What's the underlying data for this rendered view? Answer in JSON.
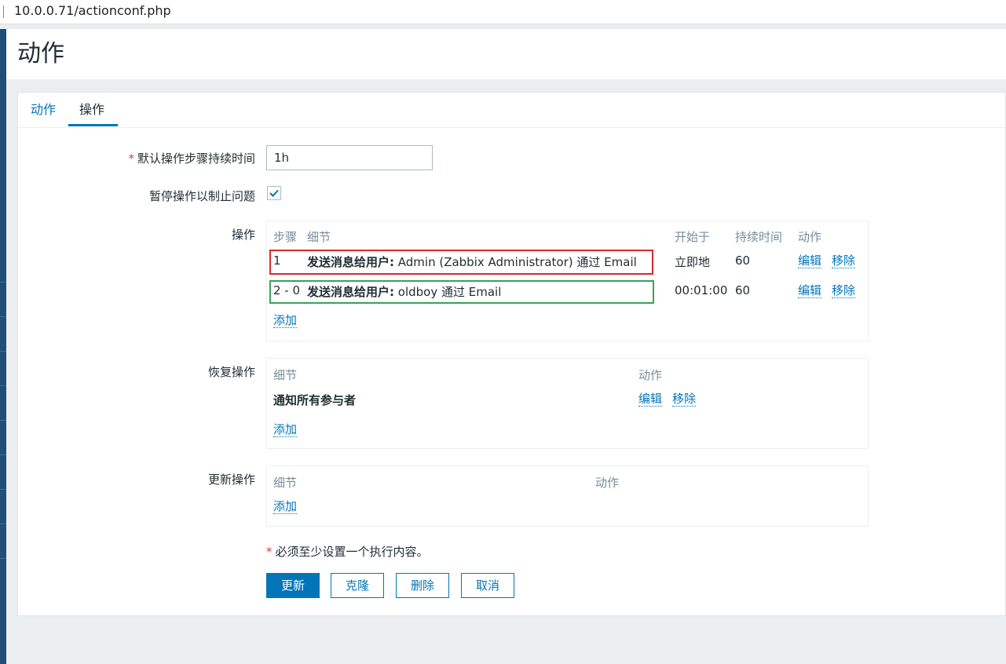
{
  "browser": {
    "url": "10.0.0.71/actionconf.php"
  },
  "page": {
    "title": "动作"
  },
  "tabs": [
    {
      "label": "动作"
    },
    {
      "label": "操作"
    }
  ],
  "form": {
    "default_duration": {
      "label": "默认操作步骤持续时间",
      "value": "1h"
    },
    "pause": {
      "label": "暂停操作以制止问题",
      "checked": true
    },
    "operations": {
      "label": "操作",
      "headers": {
        "steps": "步骤",
        "details": "细节",
        "start_in": "开始于",
        "duration": "持续时间",
        "action": "动作"
      },
      "rows": [
        {
          "steps": "1",
          "details_bold": "发送消息给用户:",
          "details_text": " Admin (Zabbix Administrator) 通过 Email",
          "start_in": "立即地",
          "duration": "60",
          "edit": "编辑",
          "remove": "移除"
        },
        {
          "steps": "2 - 0",
          "details_bold": "发送消息给用户:",
          "details_text": " oldboy 通过 Email",
          "start_in": "00:01:00",
          "duration": "60",
          "edit": "编辑",
          "remove": "移除"
        }
      ],
      "add": "添加"
    },
    "recovery": {
      "label": "恢复操作",
      "headers": {
        "details": "细节",
        "action": "动作"
      },
      "rows": [
        {
          "details_bold": "通知所有参与者",
          "edit": "编辑",
          "remove": "移除"
        }
      ],
      "add": "添加"
    },
    "update": {
      "label": "更新操作",
      "headers": {
        "details": "细节",
        "action": "动作"
      },
      "add": "添加"
    },
    "note": "必须至少设置一个执行内容。",
    "buttons": {
      "update": "更新",
      "clone": "克隆",
      "delete": "删除",
      "cancel": "取消"
    }
  },
  "colors": {
    "accent": "#0275b8",
    "required": "#e33734",
    "highlight_red": "#d9292f",
    "highlight_green": "#3aa05a"
  }
}
